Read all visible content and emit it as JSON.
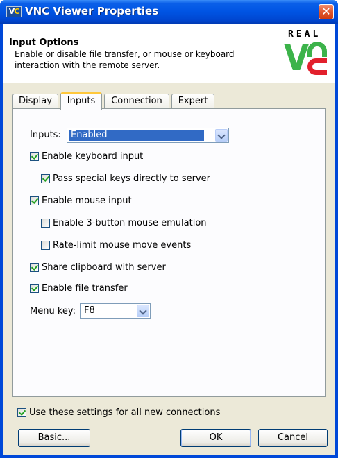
{
  "window": {
    "title": "VNC Viewer Properties",
    "app_icon": "vnc-logo-icon",
    "icon_text_v": "V",
    "icon_text_c": "C",
    "close_glyph": "✕"
  },
  "header": {
    "title": "Input Options",
    "description": "Enable or disable file transfer, or mouse or keyboard interaction with the remote server.",
    "logo_text": "REAL"
  },
  "tabs": [
    {
      "label": "Display",
      "active": false
    },
    {
      "label": "Inputs",
      "active": true
    },
    {
      "label": "Connection",
      "active": false
    },
    {
      "label": "Expert",
      "active": false
    }
  ],
  "inputs_panel": {
    "inputs_label": "Inputs:",
    "inputs_value": "Enabled",
    "checkboxes": [
      {
        "label": "Enable keyboard input",
        "checked": true
      },
      {
        "label": "Pass special keys directly to server",
        "checked": true
      },
      {
        "label": "Enable mouse input",
        "checked": true
      },
      {
        "label": "Enable 3-button mouse emulation",
        "checked": false
      },
      {
        "label": "Rate-limit mouse move events",
        "checked": false
      },
      {
        "label": "Share clipboard with server",
        "checked": true
      },
      {
        "label": "Enable file transfer",
        "checked": true
      }
    ],
    "menu_key_label": "Menu key:",
    "menu_key_value": "F8"
  },
  "footer": {
    "use_for_all_label": "Use these settings for all new connections",
    "use_for_all_checked": true,
    "basic_button": "Basic...",
    "ok_button": "OK",
    "cancel_button": "Cancel"
  },
  "colors": {
    "titlebar": "#0054e3",
    "dialog_bg": "#ece9d8",
    "selection": "#316ac5",
    "logo_green": "#3cb34a",
    "logo_red": "#e2202c"
  }
}
